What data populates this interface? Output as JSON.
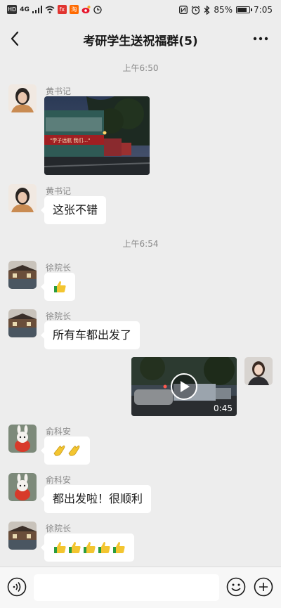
{
  "status": {
    "time": "7:05",
    "battery": "85%",
    "battery_level": 0.85,
    "left_icons": [
      "hd-icon",
      "signal-4g-icon",
      "signal-bars-icon",
      "wifi-icon",
      "app-notification-icons",
      "weibo-icon",
      "clock-icon"
    ],
    "right_icons": [
      "nfc-icon",
      "alarm-icon",
      "bluetooth-icon",
      "battery-icon"
    ],
    "hd_label": "HD",
    "net_label": "4G",
    "app1_label": "fx",
    "app2_label": "淘"
  },
  "header": {
    "title": "考研学生送祝福群(5)"
  },
  "chat": {
    "timestamps": [
      "上午6:50",
      "上午6:54"
    ],
    "messages": [
      {
        "sender": "黄书记",
        "type": "image",
        "image_text": "\"学子远航 我们...\""
      },
      {
        "sender": "黄书记",
        "type": "text",
        "text": "这张不错"
      },
      {
        "sender": "徐院长",
        "type": "emoji",
        "emojis": [
          "thumbs-up"
        ]
      },
      {
        "sender": "徐院长",
        "type": "text",
        "text": "所有车都出发了"
      },
      {
        "sender": "me",
        "type": "video",
        "duration": "0:45"
      },
      {
        "sender": "俞科安",
        "type": "emoji",
        "emojis": [
          "clap",
          "clap"
        ]
      },
      {
        "sender": "俞科安",
        "type": "text",
        "text": "都出发啦！很顺利"
      },
      {
        "sender": "徐院长",
        "type": "emoji",
        "emojis": [
          "thumbs-up",
          "thumbs-up",
          "thumbs-up",
          "thumbs-up",
          "thumbs-up"
        ]
      }
    ]
  },
  "colors": {
    "background": "#ededed",
    "bubble": "#ffffff",
    "meta_text": "#888888",
    "emoji_yellow": "#f3c530",
    "emoji_green": "#2a9d3e"
  }
}
